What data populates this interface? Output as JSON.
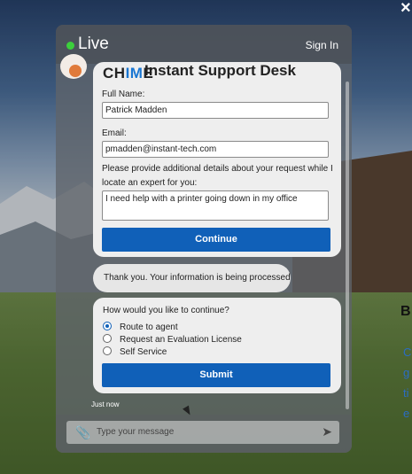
{
  "header": {
    "live_label": "Live",
    "sign_in": "Sign In"
  },
  "form": {
    "brand": "CHIME",
    "title": "Instant Support Desk",
    "full_name_label": "Full Name:",
    "full_name_value": "Patrick Madden",
    "email_label": "Email:",
    "email_value": "pmadden@instant-tech.com",
    "details_label": "Please provide additional details about your request while I locate an expert for you:",
    "details_value": "I need help with a printer going down in my office",
    "continue_label": "Continue"
  },
  "status_message": "Thank you. Your information is being processed",
  "choice": {
    "question": "How would you like to continue?",
    "options": [
      {
        "label": "Route to agent",
        "selected": true
      },
      {
        "label": "Request an Evaluation License",
        "selected": false
      },
      {
        "label": "Self Service",
        "selected": false
      }
    ],
    "submit_label": "Submit"
  },
  "timestamp": "Just now",
  "composer": {
    "placeholder": "Type your message"
  },
  "colors": {
    "accent": "#1060b8",
    "live": "#3ccf3c"
  },
  "icons": {
    "attach": "paperclip-icon",
    "send": "send-icon",
    "close": "close-icon"
  }
}
